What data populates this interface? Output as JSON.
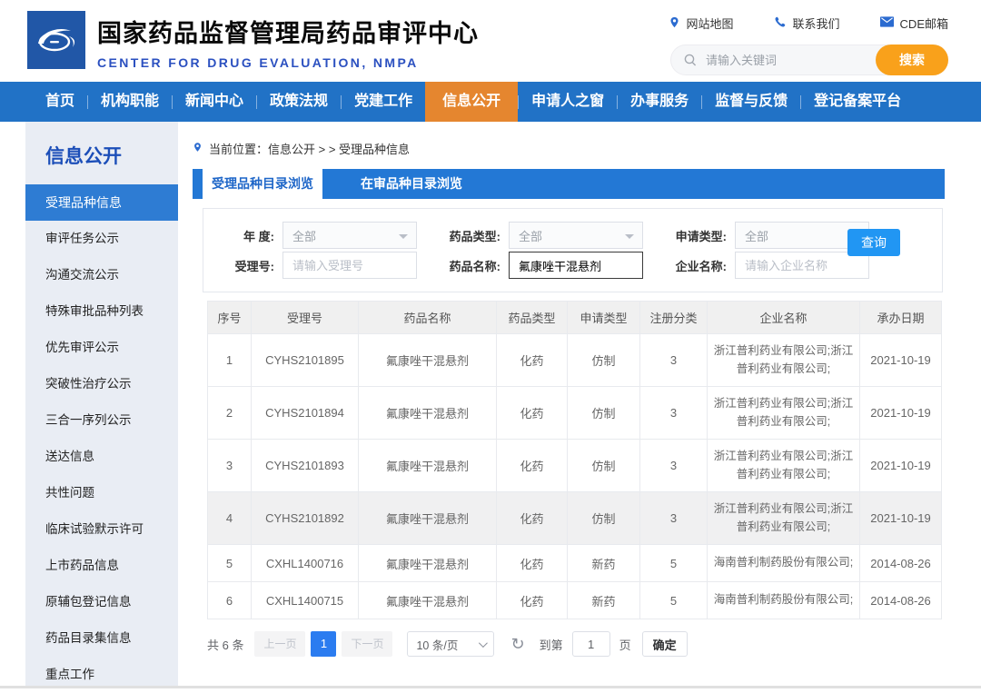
{
  "header": {
    "title_cn": "国家药品监督管理局药品审评中心",
    "title_en": "CENTER FOR DRUG EVALUATION, NMPA",
    "links": [
      {
        "icon": "location-pin-icon",
        "label": "网站地图"
      },
      {
        "icon": "phone-icon",
        "label": "联系我们"
      },
      {
        "icon": "envelope-icon",
        "label": "CDE邮箱"
      }
    ],
    "search": {
      "placeholder": "请输入关键词",
      "button": "搜索"
    }
  },
  "nav": {
    "items": [
      "首页",
      "机构职能",
      "新闻中心",
      "政策法规",
      "党建工作",
      "信息公开",
      "申请人之窗",
      "办事服务",
      "监督与反馈",
      "登记备案平台"
    ],
    "active": "信息公开"
  },
  "sidebar": {
    "title": "信息公开",
    "active": "受理品种信息",
    "items": [
      "受理品种信息",
      "审评任务公示",
      "沟通交流公示",
      "特殊审批品种列表",
      "优先审评公示",
      "突破性治疗公示",
      "三合一序列公示",
      "送达信息",
      "共性问题",
      "临床试验默示许可",
      "上市药品信息",
      "原辅包登记信息",
      "药品目录集信息",
      "重点工作"
    ]
  },
  "breadcrumb": {
    "text": "当前位置：信息公开 > > 受理品种信息"
  },
  "tabs": [
    {
      "label": "受理品种目录浏览",
      "active": true
    },
    {
      "label": "在审品种目录浏览",
      "active": false
    }
  ],
  "filters": {
    "year": {
      "label": "年 度:",
      "value": "全部"
    },
    "drug_type": {
      "label": "药品类型:",
      "value": "全部"
    },
    "apply_type": {
      "label": "申请类型:",
      "value": "全部"
    },
    "acceptance_no": {
      "label": "受理号:",
      "placeholder": "请输入受理号"
    },
    "drug_name": {
      "label": "药品名称:",
      "value": "氟康唑干混悬剂"
    },
    "company": {
      "label": "企业名称:",
      "placeholder": "请输入企业名称"
    },
    "query_button": "查询"
  },
  "table": {
    "headers": [
      "序号",
      "受理号",
      "药品名称",
      "药品类型",
      "申请类型",
      "注册分类",
      "企业名称",
      "承办日期"
    ],
    "rows": [
      [
        "1",
        "CYHS2101895",
        "氟康唑干混悬剂",
        "化药",
        "仿制",
        "3",
        "浙江普利药业有限公司;浙江普利药业有限公司;",
        "2021-10-19"
      ],
      [
        "2",
        "CYHS2101894",
        "氟康唑干混悬剂",
        "化药",
        "仿制",
        "3",
        "浙江普利药业有限公司;浙江普利药业有限公司;",
        "2021-10-19"
      ],
      [
        "3",
        "CYHS2101893",
        "氟康唑干混悬剂",
        "化药",
        "仿制",
        "3",
        "浙江普利药业有限公司;浙江普利药业有限公司;",
        "2021-10-19"
      ],
      [
        "4",
        "CYHS2101892",
        "氟康唑干混悬剂",
        "化药",
        "仿制",
        "3",
        "浙江普利药业有限公司;浙江普利药业有限公司;",
        "2021-10-19"
      ],
      [
        "5",
        "CXHL1400716",
        "氟康唑干混悬剂",
        "化药",
        "新药",
        "5",
        "海南普利制药股份有限公司;",
        "2014-08-26"
      ],
      [
        "6",
        "CXHL1400715",
        "氟康唑干混悬剂",
        "化药",
        "新药",
        "5",
        "海南普利制药股份有限公司;",
        "2014-08-26"
      ]
    ],
    "highlighted_row_index": 3
  },
  "pagination": {
    "total": "共 6 条",
    "prev": "上一页",
    "page": "1",
    "next": "下一页",
    "page_size": "10 条/页",
    "refresh_icon": "↻",
    "goto_label": "到第",
    "goto_value": "1",
    "goto_unit": "页",
    "confirm": "确定"
  },
  "colors": {
    "nav_blue": "#2172c6",
    "nav_active_orange": "#e5862f",
    "search_orange": "#f9a11b",
    "tab_blue": "#2378d5",
    "sidebar_bg": "#e9edf4",
    "sidebar_active_blue": "#2e7cd3",
    "query_button_blue": "#2196f3",
    "pagination_active_blue": "#2b7cf0",
    "logo_blue": "#2157a7",
    "title_en_blue": "#2b50c0"
  }
}
